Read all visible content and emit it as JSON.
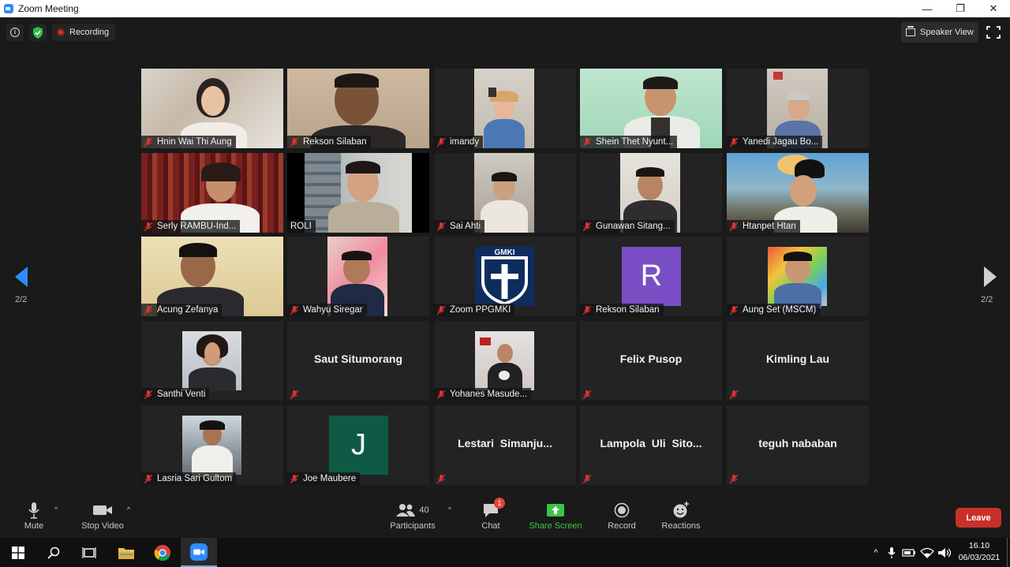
{
  "window": {
    "title": "Zoom Meeting",
    "minimize": "—",
    "restore": "❐",
    "close": "✕"
  },
  "topbar": {
    "info": "i",
    "recording_label": "Recording",
    "speaker_view_label": "Speaker View"
  },
  "pagination": {
    "left_page": "2/2",
    "right_page": "2/2"
  },
  "colors": {
    "background": "#1a1a1a",
    "tile": "#232323",
    "leave": "#c8312a",
    "share_green": "#3cc44a",
    "avatar_purple": "#7a4fc6",
    "avatar_green": "#0e5a45"
  },
  "participants": [
    {
      "name": "Hnin Wai Thi Aung",
      "kind": "video"
    },
    {
      "name": "Rekson Silaban",
      "kind": "video"
    },
    {
      "name": "imandy",
      "kind": "video"
    },
    {
      "name": "Shein Thet Nyunt...",
      "kind": "video"
    },
    {
      "name": "Yanedi Jagau Bo...",
      "kind": "video"
    },
    {
      "name": "Serly RAMBU-Ind...",
      "kind": "video"
    },
    {
      "name": "ROLI",
      "kind": "video"
    },
    {
      "name": "Sai Ahti",
      "kind": "video"
    },
    {
      "name": "Gunawan Sitang...",
      "kind": "video"
    },
    {
      "name": "Htanpet Htan",
      "kind": "video"
    },
    {
      "name": "Acung Zefanya",
      "kind": "video"
    },
    {
      "name": "Wahyu Siregar",
      "kind": "video"
    },
    {
      "name": "Zoom PPGMKI",
      "kind": "logo",
      "logo_text": "GMKI"
    },
    {
      "name": "Rekson Silaban",
      "kind": "letter",
      "letter": "R"
    },
    {
      "name": "Aung Set (MSCM)",
      "kind": "video"
    },
    {
      "name": "Santhi Venti",
      "kind": "video"
    },
    {
      "name": "Saut Situmorang",
      "kind": "text"
    },
    {
      "name": "Yohanes Masude...",
      "kind": "video"
    },
    {
      "name": "Felix Pusop",
      "kind": "text"
    },
    {
      "name": "Kimling Lau",
      "kind": "text"
    },
    {
      "name": "Lasria Sari Gultom",
      "kind": "video"
    },
    {
      "name": "Joe Maubere",
      "kind": "letter",
      "letter": "J"
    },
    {
      "name": "Lestari  Simanju...",
      "kind": "text"
    },
    {
      "name": "Lampola  Uli  Sito...",
      "kind": "text"
    },
    {
      "name": "teguh nababan",
      "kind": "text"
    }
  ],
  "toolbar": {
    "mute_label": "Mute",
    "stop_video_label": "Stop Video",
    "participants_label": "Participants",
    "participants_count": "40",
    "chat_label": "Chat",
    "chat_badge": "1",
    "share_screen_label": "Share Screen",
    "record_label": "Record",
    "reactions_label": "Reactions",
    "leave_label": "Leave"
  },
  "taskbar": {
    "time": "16.10",
    "date": "06/03/2021"
  }
}
